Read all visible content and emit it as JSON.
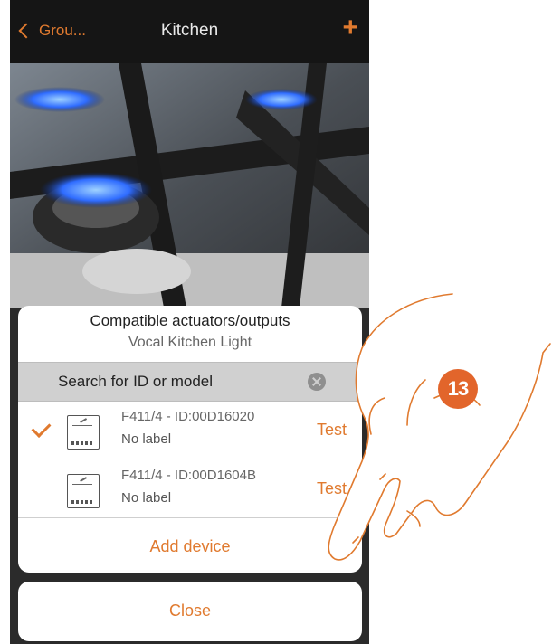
{
  "header": {
    "back_label": "Grou...",
    "title": "Kitchen",
    "add_icon": "plus-icon"
  },
  "colors": {
    "accent": "#e07a2f",
    "header_bg": "#151515",
    "search_bg": "#d0d0d0",
    "step_badge": "#e2652b"
  },
  "panel": {
    "title": "Compatible actuators/outputs",
    "subtitle": "Vocal Kitchen Light",
    "search_placeholder": "Search for ID or model",
    "devices": [
      {
        "model": "F411/4 - ID:00D16020",
        "label": "No label",
        "action": "Test",
        "selected": true
      },
      {
        "model": "F411/4 - ID:00D1604B",
        "label": "No label",
        "action": "Test",
        "selected": false
      }
    ],
    "add_device_label": "Add device"
  },
  "close_label": "Close",
  "step_number": "13"
}
